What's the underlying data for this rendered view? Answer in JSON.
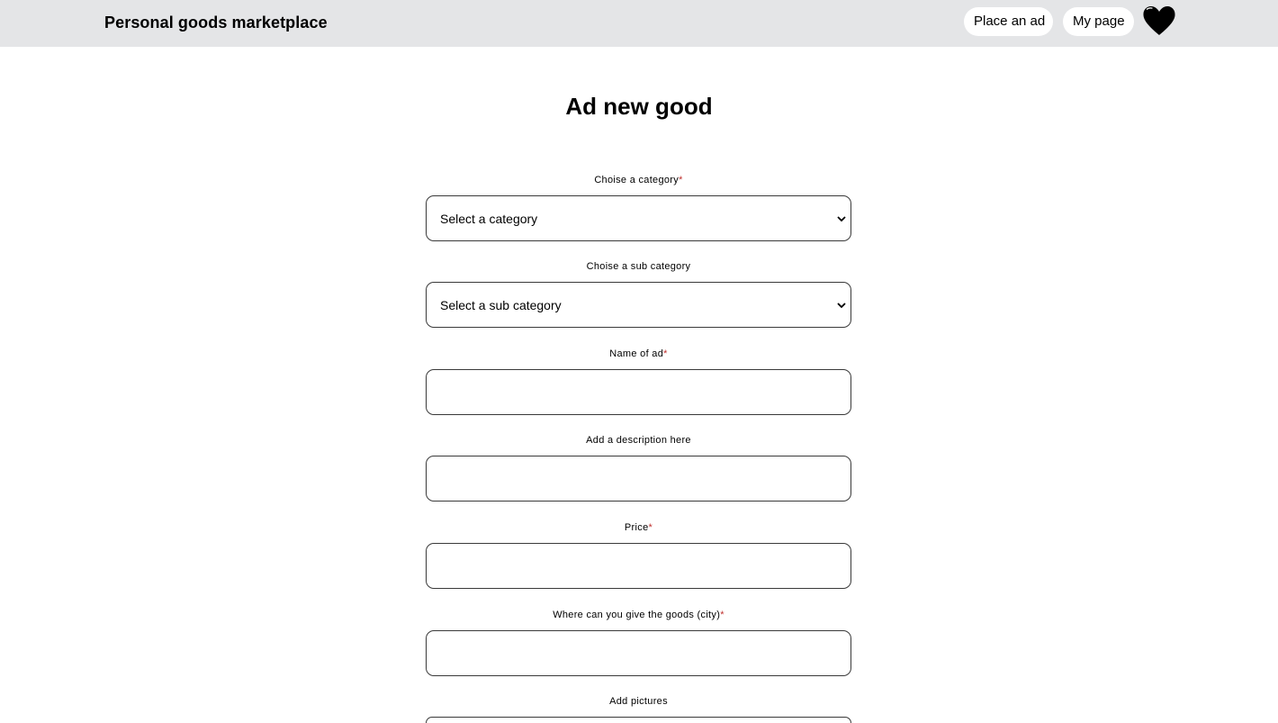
{
  "header": {
    "brand": "Personal goods marketplace",
    "place_ad_label": "Place an ad",
    "my_page_label": "My page",
    "favorites_icon": "heart-icon"
  },
  "page": {
    "title": "Ad new good"
  },
  "form": {
    "category": {
      "label": "Choise a category",
      "required_mark": "*",
      "selected": "Select a category"
    },
    "sub_category": {
      "label": "Choise a sub category",
      "selected": "Select a sub category"
    },
    "name": {
      "label": "Name of ad",
      "required_mark": "*",
      "value": ""
    },
    "description": {
      "label": "Add a description here",
      "value": ""
    },
    "price": {
      "label": "Price",
      "required_mark": "*",
      "value": ""
    },
    "city": {
      "label": "Where can you give the goods (city)",
      "required_mark": "*",
      "value": ""
    },
    "pictures": {
      "label": "Add pictures"
    }
  },
  "colors": {
    "header_bg": "#e4e5e7",
    "required_mark": "#c0312e",
    "field_border": "#3a3a3a"
  }
}
